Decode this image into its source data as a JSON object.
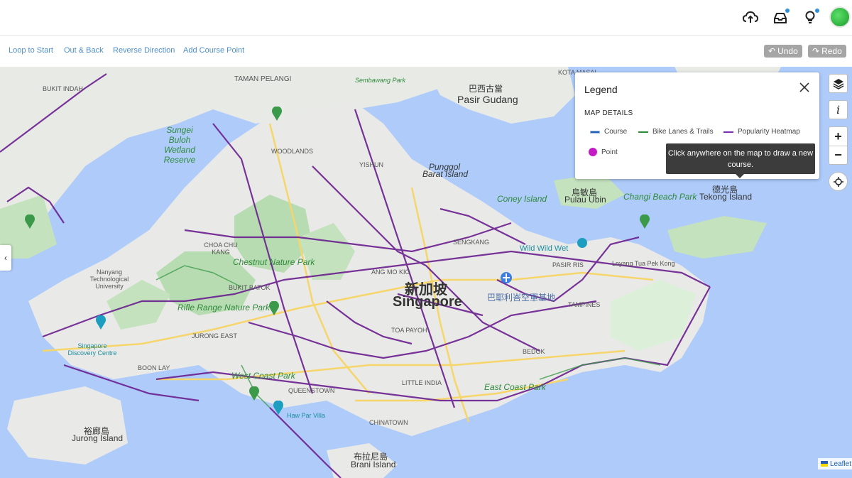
{
  "toolbar": {
    "loop_to_start": "Loop to Start",
    "out_and_back": "Out & Back",
    "reverse_direction": "Reverse Direction",
    "add_course_point": "Add Course Point",
    "undo": "Undo",
    "redo": "Redo"
  },
  "legend": {
    "title": "Legend",
    "subtitle": "MAP DETAILS",
    "items": [
      {
        "label": "Course",
        "color": "#1f5fb4"
      },
      {
        "label": "Bike Lanes & Trails",
        "color": "#2e8b3a"
      },
      {
        "label": "Popularity Heatmap",
        "color": "#7a2fb0"
      },
      {
        "label": "Point",
        "color": "#c51bc5"
      }
    ]
  },
  "tooltip": "Click anywhere on the map to draw a new course.",
  "map_controls": {
    "zoom_in": "+",
    "zoom_out": "−",
    "info": "i"
  },
  "attribution": "Leaflet",
  "map_labels": {
    "singapore_cn": "新加坡",
    "singapore": "Singapore",
    "pasir_gudang_cn": "巴西古當",
    "pasir_gudang": "Pasir Gudang",
    "woodlands": "WOODLANDS",
    "yishun": "YISHUN",
    "punggol_cn": "Punggol",
    "punggol": "Barat Island",
    "coney": "Coney Island",
    "pulau_ubin_cn": "烏敏島",
    "pulau_ubin": "Pulau Ubin",
    "changi_beach": "Changi Beach Park",
    "tekong_cn": "德光島",
    "tekong": "Tekong Island",
    "sungei_buloh": "Sungei Buloh Wetland Reserve",
    "chestnut": "Chestnut Nature Park",
    "rifle_range": "Rifle Range Nature Park",
    "jurong_east": "JURONG EAST",
    "jurong_island_cn": "裕廊島",
    "jurong_island": "Jurong Island",
    "brani_cn": "布拉尼島",
    "brani": "Brani Island",
    "toa_payoh": "TOA PAYOH",
    "tampines": "TAMPINES",
    "bedok": "BEDOK",
    "pasir_ris": "PASIR RIS",
    "ang_mo_kio": "ANG MO KIO",
    "sengkang": "SENGKANG",
    "paya_lebar_cn": "巴耶利峇空軍基地",
    "west_coast": "West Coast Park",
    "east_coast": "East Coast Park",
    "queenstown": "QUEENSTOWN",
    "bukit_batok": "BUKIT BATOK",
    "choa_chu_kang": "CHOA CHU KANG",
    "boon_lay": "BOON LAY",
    "taman_pelangi": "TAMAN PELANGI",
    "kota_masai": "KOTA MASAI",
    "sembawang": "Sembawang Park",
    "bukit_indah": "BUKIT INDAH",
    "ntu": "Nanyang Technological University",
    "discovery": "Singapore Discovery Centre",
    "haw_par": "Haw Par Villa",
    "wild_wild_wet": "Wild Wild Wet",
    "changi_tua": "Loyang Tua Pek Kong",
    "chinatown": "CHINATOWN",
    "little_india": "LITTLE INDIA"
  }
}
